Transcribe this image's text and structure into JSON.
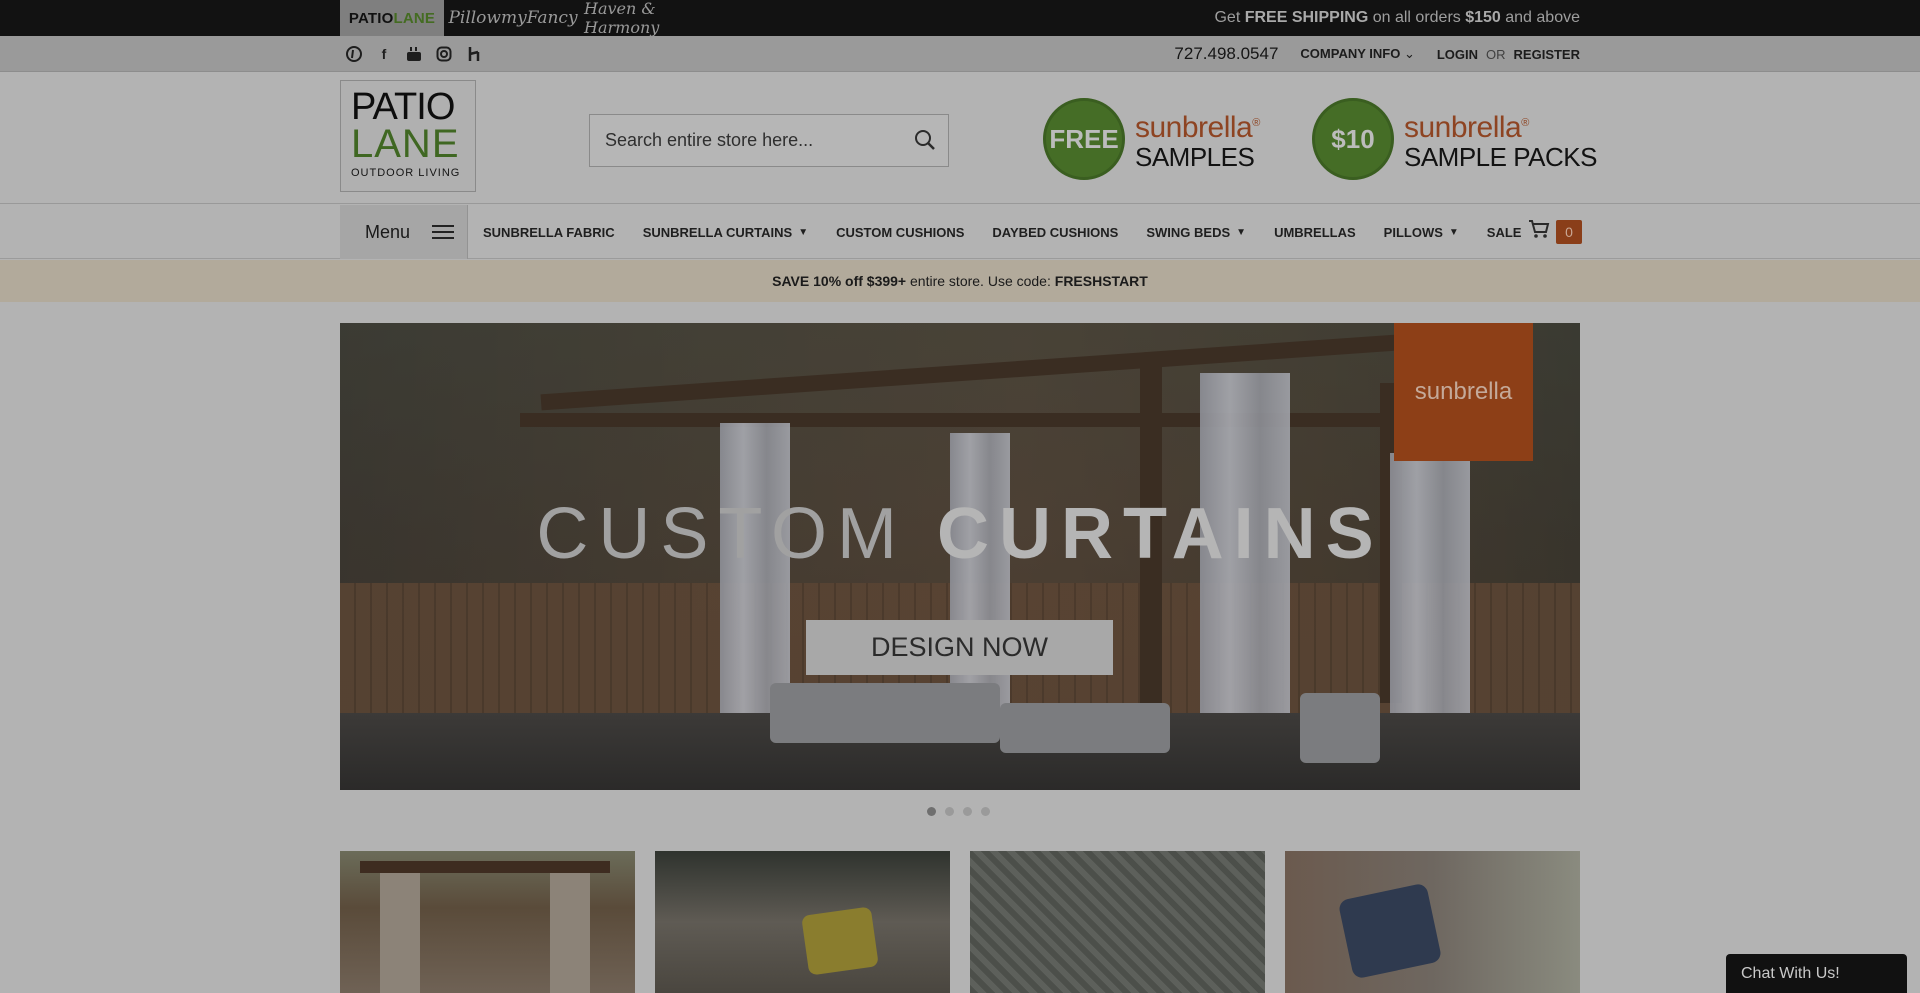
{
  "topbar": {
    "brands": [
      {
        "part1": "PATIO",
        "part2": "LANE"
      },
      {
        "label": "PillowmyFancy"
      },
      {
        "label": "Haven & Harmony"
      }
    ],
    "shipping": {
      "pre": "Get ",
      "bold1": "FREE SHIPPING",
      "mid": " on all orders ",
      "bold2": "$150",
      "post": " and above"
    }
  },
  "utility": {
    "socials": [
      "pinterest-icon",
      "facebook-icon",
      "youtube-icon",
      "instagram-icon",
      "houzz-icon"
    ],
    "phone": "727.498.0547",
    "company_info": "COMPANY INFO",
    "login": "LOGIN",
    "or": "OR",
    "register": "REGISTER"
  },
  "header": {
    "logo": {
      "line1": "PATIO",
      "line2": "LANE",
      "line3": "OUTDOOR LIVING"
    },
    "search": {
      "placeholder": "Search entire store here..."
    },
    "promos": [
      {
        "badge": "FREE",
        "brand": "sunbrella",
        "sub": "SAMPLES"
      },
      {
        "badge": "$10",
        "brand": "sunbrella",
        "sub": "SAMPLE PACKS"
      }
    ]
  },
  "nav": {
    "menu_label": "Menu",
    "items": [
      {
        "label": "SUNBRELLA FABRIC",
        "dropdown": false
      },
      {
        "label": "SUNBRELLA CURTAINS",
        "dropdown": true
      },
      {
        "label": "CUSTOM CUSHIONS",
        "dropdown": false
      },
      {
        "label": "DAYBED CUSHIONS",
        "dropdown": false
      },
      {
        "label": "SWING BEDS",
        "dropdown": true
      },
      {
        "label": "UMBRELLAS",
        "dropdown": false
      },
      {
        "label": "PILLOWS",
        "dropdown": true
      },
      {
        "label": "SALE",
        "dropdown": false
      }
    ],
    "cart_count": "0"
  },
  "coupon": {
    "bold1": "SAVE 10% off $399+",
    "mid": " entire store. Use code: ",
    "code": "FRESHSTART"
  },
  "hero": {
    "title_light": "CUSTOM ",
    "title_bold": "CURTAINS",
    "cta": "DESIGN NOW",
    "badge": "sunbrella",
    "slides": 4,
    "active_slide": 1
  },
  "chat": {
    "label": "Chat With Us!"
  }
}
